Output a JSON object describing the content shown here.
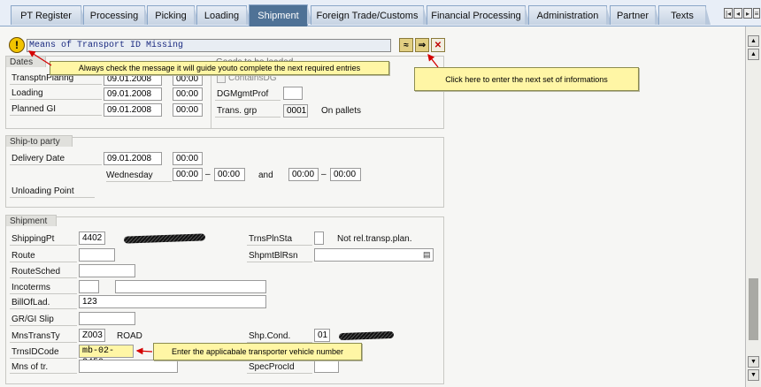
{
  "tabs": [
    "PT Register",
    "Processing",
    "Picking",
    "Loading",
    "Shipment",
    "Foreign Trade/Customs",
    "Financial Processing",
    "Administration",
    "Partner",
    "Texts"
  ],
  "active_tab": "Shipment",
  "message": "Means of Transport ID Missing",
  "callouts": {
    "message_hint": "Always check the message it  will guide youto complete the next  required entries",
    "next_button_hint": "Click here to enter the next  set  of  informations",
    "vehicle_hint": "Enter  the applicabale transporter  vehicle number"
  },
  "dates": {
    "title": "Dates",
    "rows": [
      {
        "label": "TransptnPlanng",
        "date": "09.01.2008",
        "time": "00:00"
      },
      {
        "label": "Loading",
        "date": "09.01.2008",
        "time": "00:00"
      },
      {
        "label": "Planned GI",
        "date": "09.01.2008",
        "time": "00:00"
      }
    ]
  },
  "goods": {
    "title": "Goods to be loaded",
    "contains_dg": "ContainsDG",
    "dg_label": "DGMgmtProf",
    "dg_value": "",
    "trans_grp_label": "Trans. grp",
    "trans_grp_value": "0001",
    "trans_grp_text": "On pallets"
  },
  "ship_to": {
    "title": "Ship-to party",
    "delivery_label": "Delivery Date",
    "delivery_date": "09.01.2008",
    "delivery_time": "00:00",
    "weekday": "Wednesday",
    "from1": "00:00",
    "to1": "00:00",
    "and_text": "and",
    "from2": "00:00",
    "to2": "00:00",
    "unloading_label": "Unloading Point"
  },
  "shipment": {
    "title": "Shipment",
    "shipping_pt_label": "ShippingPt",
    "shipping_pt": "4402",
    "route_label": "Route",
    "route": "",
    "route_sched_label": "RouteSched",
    "route_sched": "",
    "incoterms_label": "Incoterms",
    "incoterms1": "",
    "incoterms2": "",
    "bill_label": "BillOfLad.",
    "bill": "123",
    "grgi_label": "GR/GI Slip",
    "grgi": "",
    "mns_trans_ty_label": "MnsTransTy",
    "mns_trans_ty": "Z003",
    "mns_trans_ty_text": "ROAD",
    "trns_id_label": "TrnsIDCode",
    "trns_id": "mb-02-3450",
    "mns_of_tr_label": "Mns of tr.",
    "mns_of_tr": "",
    "trns_pln_sta_label": "TrnsPlnSta",
    "trns_pln_sta_text": "Not rel.transp.plan.",
    "shpmt_blrsn_label": "ShpmtBlRsn",
    "shpmt_blrsn": "",
    "shp_cond_label": "Shp.Cond.",
    "shp_cond": "01",
    "spec_proc_label": "SpecProcId",
    "spec_proc": ""
  },
  "colors": {
    "accent": "#4f7296",
    "callout": "#fff6a5",
    "arrow": "#d40000"
  }
}
